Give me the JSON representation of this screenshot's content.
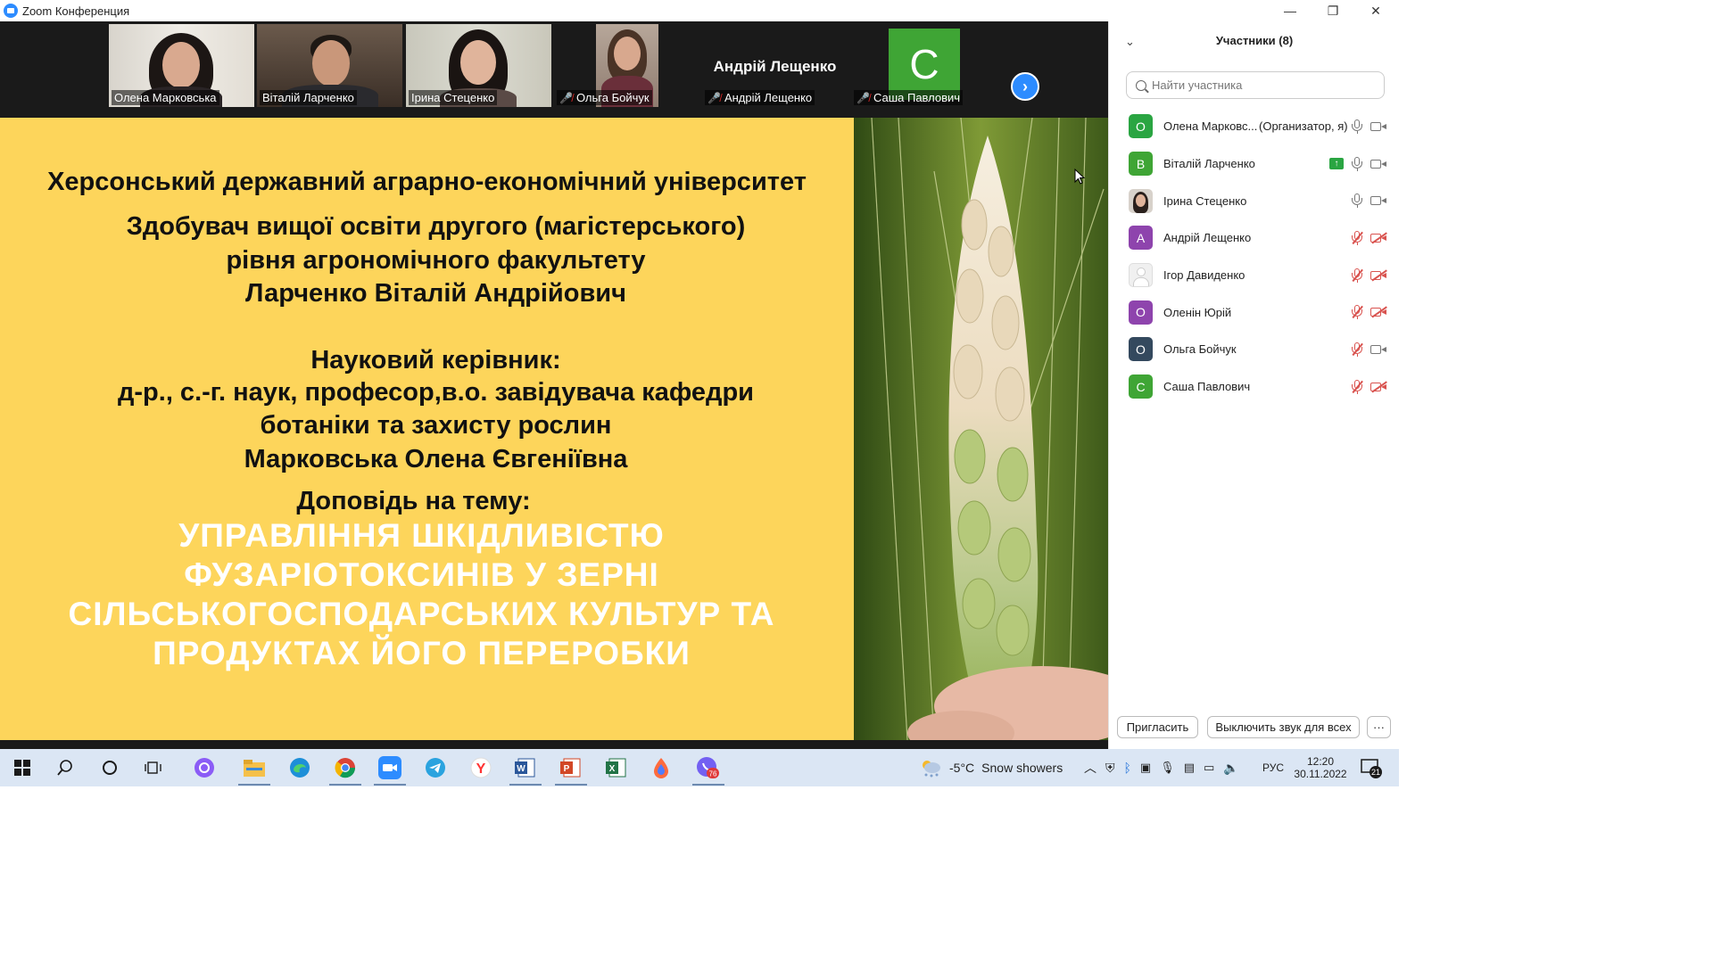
{
  "window": {
    "title": "Zoom Конференция",
    "minimize": "—",
    "restore": "❐",
    "close": "✕"
  },
  "strip": {
    "tiles": [
      {
        "name": "Олена Марковська",
        "muted": false
      },
      {
        "name": "Віталій Ларченко",
        "muted": false
      },
      {
        "name": "Ірина Стеценко",
        "muted": false,
        "active": true
      },
      {
        "name": "Ольга Бойчук",
        "muted": true
      },
      {
        "name": "Андрій Лещенко",
        "muted": true,
        "big_name": "Андрій Лещенко"
      },
      {
        "name": "Саша Павлович",
        "muted": true,
        "avatar_letter": "С"
      }
    ],
    "next_arrow": "›"
  },
  "slide": {
    "university": "Херсонський державний аграрно-економічний університет",
    "student_line1": "Здобувач вищої освіти другого (магістерського)",
    "student_line2": "рівня агрономічного факультету",
    "student_name": "Ларченко Віталій Андрійович",
    "supervisor_heading": "Науковий керівник:",
    "supervisor_line1": "д-р., с.-г. наук, професор,в.о. завідувача кафедри",
    "supervisor_line2": "ботаніки та захисту рослин",
    "supervisor_name": "Марковська Олена Євгеніївна",
    "topic_heading": "Доповідь на тему:",
    "topic_lines": [
      "УПРАВЛІННЯ ШКІДЛИВІСТЮ",
      "ФУЗАРІОТОКСИНІВ У ЗЕРНІ",
      "СІЛЬСЬКОГОСПОДАРСЬКИХ КУЛЬТУР ТА",
      "ПРОДУКТАХ ЙОГО ПЕРЕРОБКИ"
    ]
  },
  "participants": {
    "title": "Участники (8)",
    "search_placeholder": "Найти участника",
    "list": [
      {
        "name": "Олена Марковс...",
        "role": "(Организатор, я)",
        "avatar": "О",
        "color": "#2aa542",
        "mic": "on",
        "cam": "on"
      },
      {
        "name": "Віталій Ларченко",
        "avatar": "В",
        "color": "#3fa535",
        "mic": "on",
        "cam": "on",
        "sharing": true
      },
      {
        "name": "Ірина Стеценко",
        "avatar": "",
        "color": "#cfc8c0",
        "mic": "on",
        "cam": "on",
        "photo": true
      },
      {
        "name": "Андрій Лещенко",
        "avatar": "А",
        "color": "#8e44ad",
        "mic": "off",
        "cam": "off"
      },
      {
        "name": "Ігор Давиденко",
        "avatar": "",
        "color": "#e8e8e8",
        "mic": "off",
        "cam": "off",
        "blank": true
      },
      {
        "name": "Оленін Юрій",
        "avatar": "О",
        "color": "#8e44ad",
        "mic": "off",
        "cam": "off"
      },
      {
        "name": "Ольга Бойчук",
        "avatar": "О",
        "color": "#34495e",
        "mic": "off",
        "cam": "on"
      },
      {
        "name": "Саша Павлович",
        "avatar": "С",
        "color": "#3fa535",
        "mic": "off",
        "cam": "off"
      }
    ],
    "invite_button": "Пригласить",
    "mute_all_button": "Выключить звук для всех",
    "more_button": "···"
  },
  "taskbar": {
    "weather_temp": "-5°C",
    "weather_text": "Snow showers",
    "language": "РУС",
    "time": "12:20",
    "date": "30.11.2022",
    "notifications": "21",
    "viber_badge": "76"
  },
  "colors": {
    "slide_yellow": "#fdd55b",
    "zoom_blue": "#2d8cff",
    "muted_red": "#d9534f"
  }
}
